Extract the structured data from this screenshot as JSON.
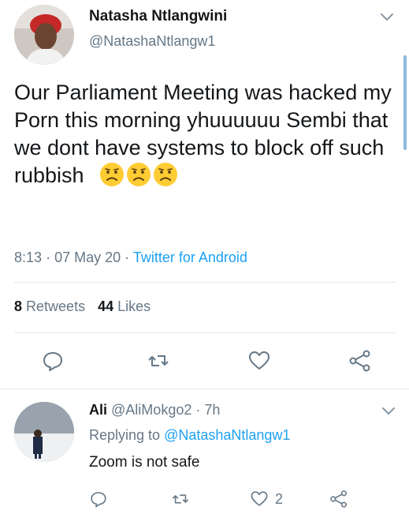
{
  "main_tweet": {
    "display_name": "Natasha Ntlangwini",
    "handle": "@NatashaNtlangw1",
    "text": "Our Parliament Meeting was hacked my Porn this morning yhuuuuuu Sembi that we dont have systems to block off such rubbish",
    "emojis": [
      "frowning-face-emoji",
      "frowning-face-emoji",
      "frowning-face-emoji"
    ],
    "time": "8:13",
    "date": "07 May 20",
    "source": "Twitter for Android",
    "retweets_count": "8",
    "retweets_label": "Retweets",
    "likes_count": "44",
    "likes_label": "Likes"
  },
  "reply": {
    "display_name": "Ali",
    "handle": "@AliMokgo2",
    "age": "7h",
    "replying_to_label": "Replying to",
    "replying_to_handle": "@NatashaNtlangw1",
    "text": "Zoom is not safe",
    "likes_count": "2"
  },
  "icons": [
    "reply-icon",
    "retweet-icon",
    "heart-icon",
    "share-icon",
    "chevron-down-icon"
  ],
  "colors": {
    "link": "#1da1f2",
    "secondary_text": "#657786",
    "primary_text": "#14171a",
    "divider": "#e1e8ed"
  }
}
